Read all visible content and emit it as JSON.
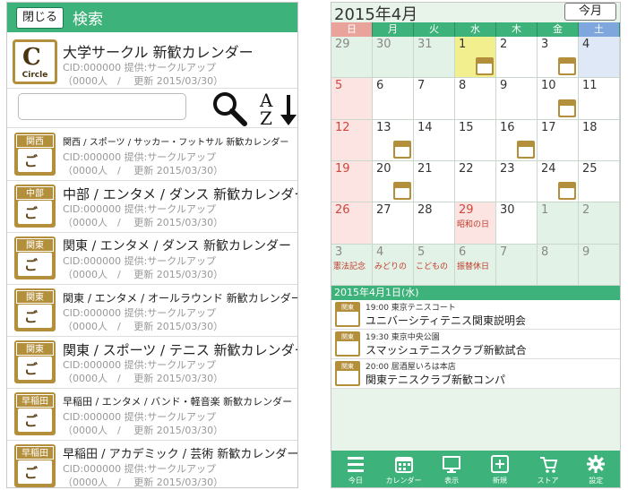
{
  "left": {
    "close_label": "閉じる",
    "title": "検索",
    "top_item": {
      "icon_word": "Circle",
      "name": "大学サークル 新歓カレンダー",
      "cid": "CID:000000 提供:サークルアップ",
      "stats": "（0000人　/　 更新 2015/03/30）"
    },
    "items": [
      {
        "label": "関西",
        "name": "関西 / スポーツ / サッカー・フットサル 新歓カレンダー",
        "cid": "CID:000000 提供:サークルアップ",
        "stats": "（0000人　/　 更新 2015/03/30）"
      },
      {
        "label": "中部",
        "name": "中部 / エンタメ / ダンス 新歓カレンダー",
        "cid": "CID:000000 提供:サークルアップ",
        "stats": "（0000人　/　 更新 2015/03/30）"
      },
      {
        "label": "関東",
        "name": "関東 / エンタメ / ダンス 新歓カレンダー",
        "cid": "CID:000000 提供:サークルアップ",
        "stats": "（0000人　/　 更新 2015/03/30）"
      },
      {
        "label": "関東",
        "name": "関東 / エンタメ / オールラウンド 新歓カレンダー",
        "cid": "CID:000000 提供:サークルアップ",
        "stats": "（0000人　/　 更新 2015/03/30）"
      },
      {
        "label": "関東",
        "name": "関東 / スポーツ / テニス 新歓カレンダー",
        "cid": "CID:000000 提供:サークルアップ",
        "stats": "（0000人　/　 更新 2015/03/30）"
      },
      {
        "label": "早稲田",
        "name": "早稲田 / エンタメ / バンド・軽音楽 新歓カレンダー",
        "cid": "CID:000000 提供:サークルアップ",
        "stats": "（0000人　/　 更新 2015/03/30）"
      },
      {
        "label": "早稲田",
        "name": "早稲田 / アカデミック / 芸術 新歓カレンダー",
        "cid": "CID:000000 提供:サークルアップ",
        "stats": "（0000人　/　 更新 2015/03/30）"
      }
    ]
  },
  "right": {
    "month_title": "2015年4月",
    "today_label": "今月",
    "weekdays": [
      "日",
      "月",
      "火",
      "水",
      "木",
      "金",
      "土"
    ],
    "weeks": [
      [
        {
          "d": "29",
          "t": "other"
        },
        {
          "d": "30",
          "t": "other"
        },
        {
          "d": "31",
          "t": "other"
        },
        {
          "d": "1",
          "t": "today",
          "ev": true
        },
        {
          "d": "2",
          "t": "normal"
        },
        {
          "d": "3",
          "t": "normal",
          "ev": true
        },
        {
          "d": "4",
          "t": "sat"
        }
      ],
      [
        {
          "d": "5",
          "t": "sun"
        },
        {
          "d": "6",
          "t": "normal"
        },
        {
          "d": "7",
          "t": "normal"
        },
        {
          "d": "8",
          "t": "normal"
        },
        {
          "d": "9",
          "t": "normal"
        },
        {
          "d": "10",
          "t": "normal",
          "ev": true
        },
        {
          "d": "11",
          "t": "normal"
        }
      ],
      [
        {
          "d": "12",
          "t": "normal"
        },
        {
          "d": "13",
          "t": "normal",
          "ev": true
        },
        {
          "d": "14",
          "t": "normal"
        },
        {
          "d": "15",
          "t": "normal"
        },
        {
          "d": "16",
          "t": "normal",
          "ev": true
        },
        {
          "d": "17",
          "t": "normal"
        },
        {
          "d": "18",
          "t": "normal"
        }
      ],
      [
        {
          "d": "19",
          "t": "normal"
        },
        {
          "d": "20",
          "t": "normal",
          "ev": true
        },
        {
          "d": "21",
          "t": "normal"
        },
        {
          "d": "22",
          "t": "normal"
        },
        {
          "d": "23",
          "t": "normal"
        },
        {
          "d": "24",
          "t": "normal",
          "ev": true
        },
        {
          "d": "25",
          "t": "normal"
        }
      ],
      [
        {
          "d": "26",
          "t": "normal"
        },
        {
          "d": "27",
          "t": "normal"
        },
        {
          "d": "28",
          "t": "normal"
        },
        {
          "d": "29",
          "t": "holiday",
          "hol": "昭和の日"
        },
        {
          "d": "30",
          "t": "normal"
        },
        {
          "d": "1",
          "t": "other"
        },
        {
          "d": "2",
          "t": "other"
        }
      ],
      [
        {
          "d": "3",
          "t": "other",
          "hol": "憲法記念"
        },
        {
          "d": "4",
          "t": "other",
          "hol": "みどりの"
        },
        {
          "d": "5",
          "t": "other",
          "hol": "こどもの"
        },
        {
          "d": "6",
          "t": "other",
          "hol": "振替休日"
        },
        {
          "d": "7",
          "t": "other"
        },
        {
          "d": "8",
          "t": "other"
        },
        {
          "d": "9",
          "t": "other"
        }
      ]
    ],
    "day_title": "2015年4月1日(水)",
    "events": [
      {
        "label": "関東",
        "time": "19:00 東京テニスコート",
        "name": "ユニバーシティテニス関東説明会"
      },
      {
        "label": "関東",
        "time": "19:30 東京中央公園",
        "name": "スマッシュテニスクラブ新歓試合"
      },
      {
        "label": "関東",
        "time": "20:00 居酒屋いろは本店",
        "name": "関東テニスクラブ新歓コンパ"
      }
    ],
    "tabs": [
      {
        "label": "今日",
        "icon": "list-icon"
      },
      {
        "label": "カレンダー",
        "icon": "calendar-icon"
      },
      {
        "label": "表示",
        "icon": "monitor-icon"
      },
      {
        "label": "新規",
        "icon": "plus-icon"
      },
      {
        "label": "ストア",
        "icon": "cart-icon"
      },
      {
        "label": "設定",
        "icon": "gear-icon"
      }
    ]
  },
  "colors": {
    "green": "#3db27a",
    "gold": "#b38f3b",
    "today": "#f2ef8f",
    "holiday_text": "#d1463e"
  }
}
